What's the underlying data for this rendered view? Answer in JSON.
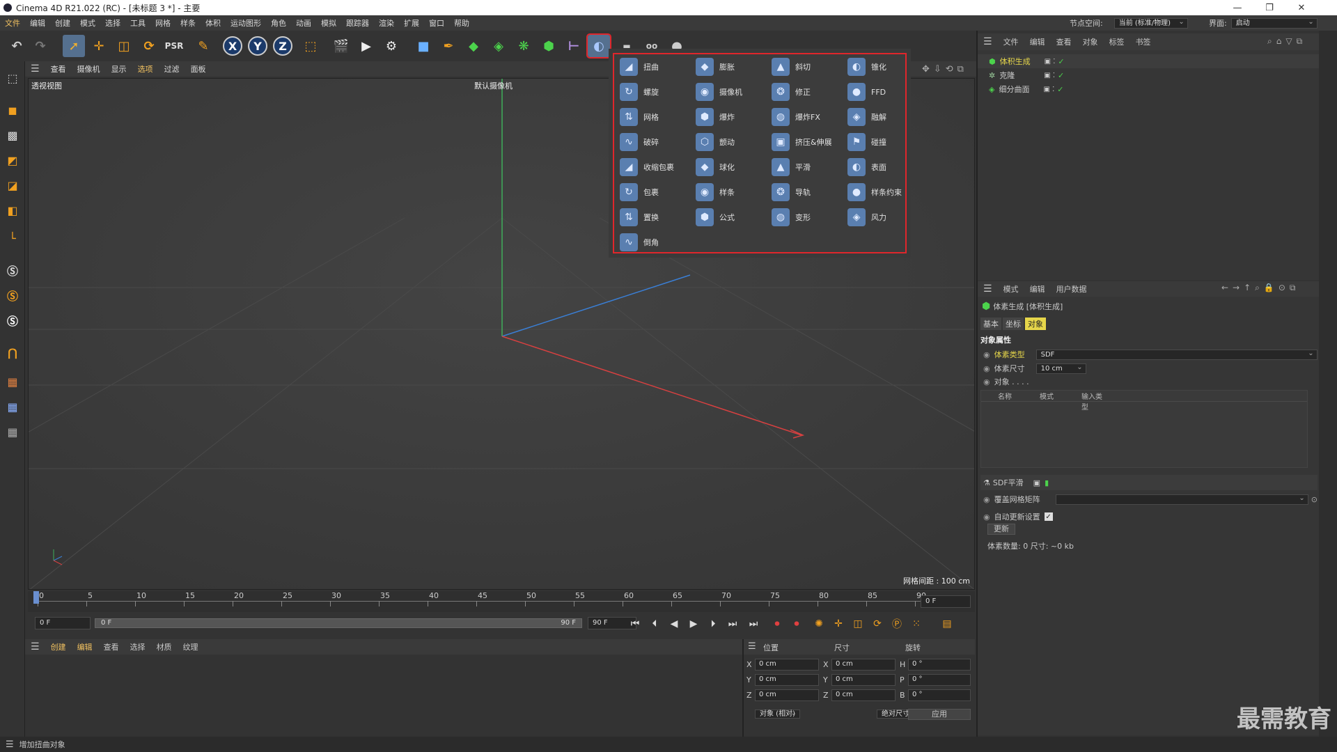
{
  "window": {
    "title": "Cinema 4D R21.022 (RC) - [未标题 3 *] - 主要"
  },
  "menubar": {
    "items": [
      "文件",
      "编辑",
      "创建",
      "模式",
      "选择",
      "工具",
      "网格",
      "样条",
      "体积",
      "运动图形",
      "角色",
      "动画",
      "模拟",
      "跟踪器",
      "渲染",
      "扩展",
      "窗口",
      "帮助"
    ],
    "node_space_label": "节点空间:",
    "node_space_value": "当前 (标准/物理)",
    "layout_label": "界面:",
    "layout_value": "启动"
  },
  "viewport": {
    "menu": [
      "查看",
      "摄像机",
      "显示",
      "选项",
      "过滤",
      "面板"
    ],
    "view_name": "透视视图",
    "camera_label": "默认摄像机",
    "grid_spacing": "网格间距 : 100 cm"
  },
  "deformer_popup": {
    "items": [
      [
        "扭曲",
        "膨胀",
        "斜切",
        "锥化"
      ],
      [
        "螺旋",
        "摄像机",
        "修正",
        "FFD"
      ],
      [
        "网格",
        "爆炸",
        "爆炸FX",
        "融解"
      ],
      [
        "破碎",
        "颤动",
        "挤压&伸展",
        "碰撞"
      ],
      [
        "收缩包裹",
        "球化",
        "平滑",
        "表面"
      ],
      [
        "包裹",
        "样条",
        "导轨",
        "样条约束"
      ],
      [
        "置换",
        "公式",
        "变形",
        "风力"
      ],
      [
        "倒角"
      ]
    ]
  },
  "timeline": {
    "ticks": [
      "0",
      "5",
      "10",
      "15",
      "20",
      "25",
      "30",
      "35",
      "40",
      "45",
      "50",
      "55",
      "60",
      "65",
      "70",
      "75",
      "80",
      "85",
      "90"
    ],
    "current_frame": "0 F"
  },
  "transport": {
    "start": "0 F",
    "range_start": "0 F",
    "range_end": "90 F",
    "end": "90 F"
  },
  "material": {
    "menu": [
      "创建",
      "编辑",
      "查看",
      "选择",
      "材质",
      "纹理"
    ]
  },
  "coords": {
    "headers": [
      "位置",
      "尺寸",
      "旋转"
    ],
    "rows": [
      {
        "a": "X",
        "pos": "0 cm",
        "b": "X",
        "size": "0 cm",
        "c": "H",
        "rot": "0 °"
      },
      {
        "a": "Y",
        "pos": "0 cm",
        "b": "Y",
        "size": "0 cm",
        "c": "P",
        "rot": "0 °"
      },
      {
        "a": "Z",
        "pos": "0 cm",
        "b": "Z",
        "size": "0 cm",
        "c": "B",
        "rot": "0 °"
      }
    ],
    "mode": "对象 (相对)",
    "size_mode": "绝对尺寸",
    "apply": "应用"
  },
  "objects": {
    "menu": [
      "文件",
      "编辑",
      "查看",
      "对象",
      "标签",
      "书签"
    ],
    "items": [
      {
        "name": "体积生成",
        "highlight": true
      },
      {
        "name": "克隆",
        "highlight": false
      },
      {
        "name": "细分曲面",
        "highlight": false
      }
    ]
  },
  "attributes": {
    "menu": [
      "模式",
      "编辑",
      "用户数据"
    ],
    "object_title": "体素生成 [体积生成]",
    "tabs": [
      "基本",
      "坐标",
      "对象"
    ],
    "section": "对象属性",
    "voxel_type_label": "体素类型",
    "voxel_type_value": "SDF",
    "voxel_size_label": "体素尺寸",
    "voxel_size_value": "10 cm",
    "objects_label": "对象 . . . .",
    "cols": [
      "名称",
      "模式",
      "输入类型"
    ],
    "sdf_label": "SDF平滑",
    "override_label": "覆盖网格矩阵",
    "auto_update_label": "自动更新设置",
    "update_button": "更新",
    "voxel_info": "体素数量: 0   尺寸: ~0 kb"
  },
  "status": {
    "text": "增加扭曲对象"
  },
  "watermark": "最需教育",
  "colors": {
    "accent_red": "#e0262b",
    "icon_blue": "#5a7fb0",
    "highlight_yellow": "#e6d64a"
  }
}
